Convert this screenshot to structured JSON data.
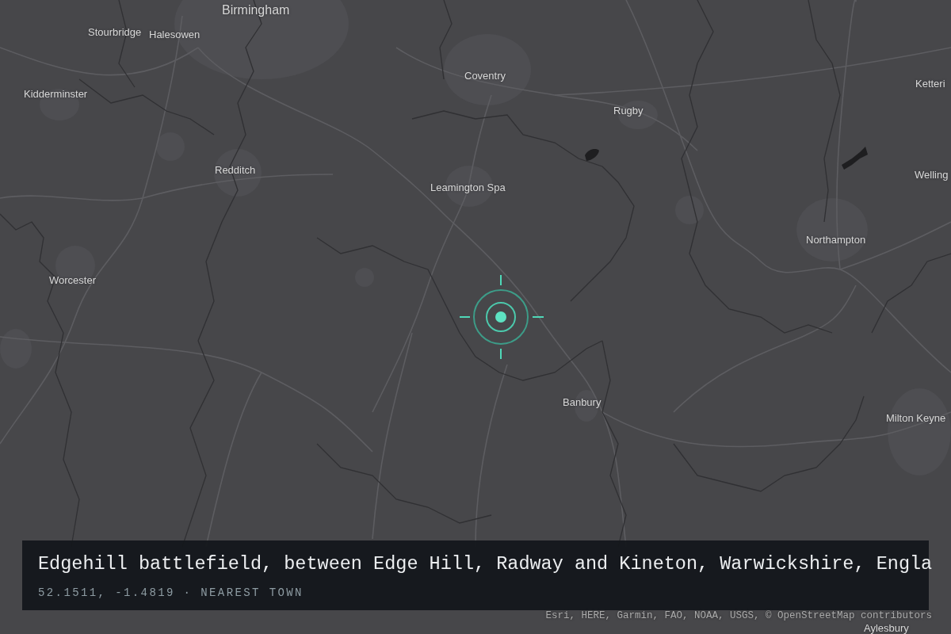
{
  "map": {
    "places": [
      {
        "name": "Birmingham",
        "kind": "city"
      },
      {
        "name": "Stourbridge",
        "kind": "town"
      },
      {
        "name": "Halesowen",
        "kind": "town"
      },
      {
        "name": "Coventry",
        "kind": "town"
      },
      {
        "name": "Ketteri",
        "kind": "town"
      },
      {
        "name": "Kidderminster",
        "kind": "town"
      },
      {
        "name": "Rugby",
        "kind": "town"
      },
      {
        "name": "Redditch",
        "kind": "town"
      },
      {
        "name": "Welling",
        "kind": "town"
      },
      {
        "name": "Leamington Spa",
        "kind": "town"
      },
      {
        "name": "Northampton",
        "kind": "town"
      },
      {
        "name": "Worcester",
        "kind": "town"
      },
      {
        "name": "Banbury",
        "kind": "town"
      },
      {
        "name": "Milton Keyne",
        "kind": "town"
      },
      {
        "name": "Aylesbury",
        "kind": "town"
      }
    ]
  },
  "caption": {
    "title": "Edgehill battlefield, between Edge Hill, Radway and Kineton, Warwickshire, Engla",
    "subtitle": "52.1511, -1.4819 · NEAREST TOWN"
  },
  "attribution": "Esri, HERE, Garmin, FAO, NOAA, USGS, © OpenStreetMap contributors"
}
